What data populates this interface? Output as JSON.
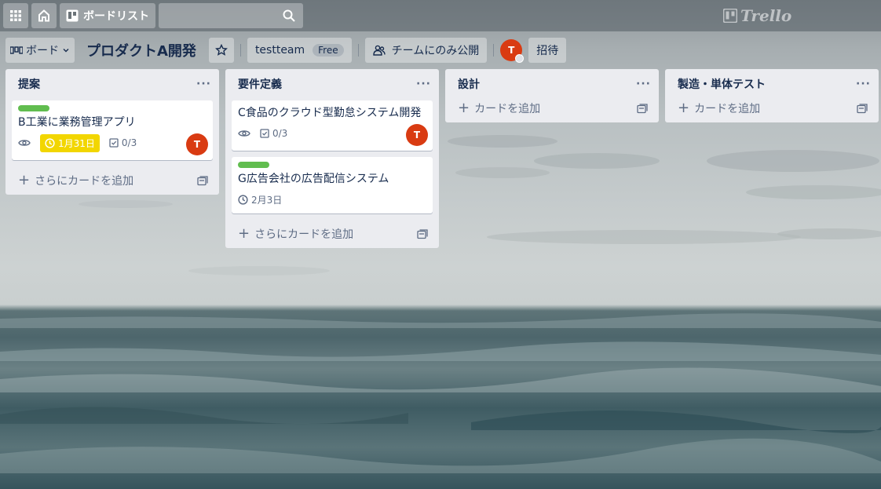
{
  "header": {
    "apps_icon": "grid-icon",
    "home_icon": "home-icon",
    "boards_label": "ボードリスト",
    "search_value": "",
    "logo_text": "Trello"
  },
  "board": {
    "switch_label": "ボード",
    "title": "プロダクトA開発",
    "team_name": "testteam",
    "team_plan": "Free",
    "visibility": "チームにのみ公開",
    "member_initial": "T",
    "invite_label": "招待"
  },
  "lists": [
    {
      "title": "提案",
      "add_label": "さらにカードを追加",
      "cards": [
        {
          "title": "B工業に業務管理アプリ",
          "label_color": "#61bd4f",
          "due": "1月31日",
          "checklist": "0/3",
          "member": "T"
        }
      ]
    },
    {
      "title": "要件定義",
      "add_label": "さらにカードを追加",
      "cards": [
        {
          "title": "C食品のクラウド型勤怠システム開発",
          "checklist": "0/3",
          "member": "T"
        },
        {
          "title": "G広告会社の広告配信システム",
          "label_color": "#61bd4f",
          "due": "2月3日"
        }
      ]
    },
    {
      "title": "設計",
      "add_label": "カードを追加",
      "cards": []
    },
    {
      "title": "製造・単体テスト",
      "add_label": "カードを追加",
      "cards": []
    }
  ],
  "colors": {
    "avatar": "#d93b12",
    "due_warning": "#f2d600",
    "label_green": "#61bd4f",
    "list_bg": "#ebecf0"
  }
}
